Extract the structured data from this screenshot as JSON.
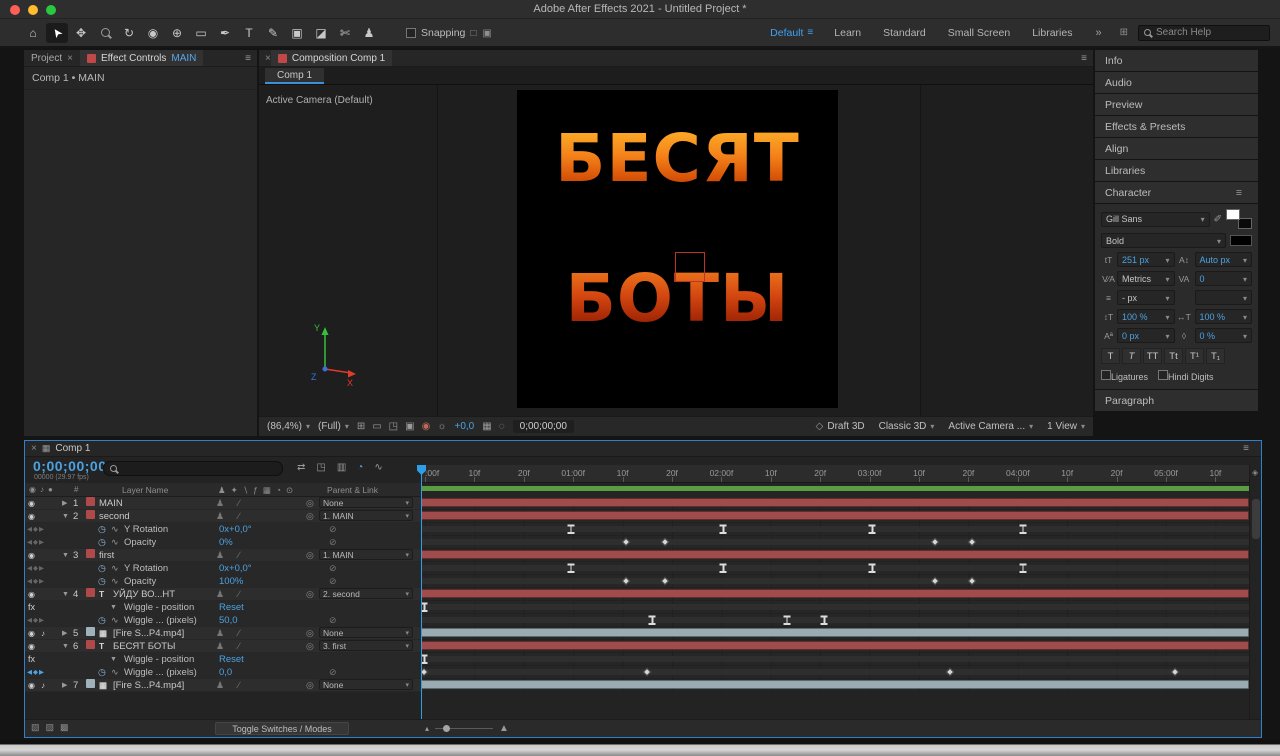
{
  "window": {
    "title": "Adobe After Effects 2021 - Untitled Project *"
  },
  "colors": {
    "accent_blue": "#4ba3e3",
    "workspace_blue": "#3ea1f4",
    "layer_red": "#a04c4c",
    "layer_gray": "#9aacb2",
    "render_green": "#5a9c41",
    "fire_orange": "#f4821a",
    "fire_red": "#c23a0a",
    "tab_chip_red": "#c04848"
  },
  "toolbar": {
    "tools": [
      {
        "name": "home",
        "glyph": "⌂"
      },
      {
        "name": "selection",
        "glyph": "➤",
        "active": true,
        "rotate": -125
      },
      {
        "name": "hand",
        "glyph": "✥"
      },
      {
        "name": "zoom",
        "glyph": "mag"
      },
      {
        "name": "orbit",
        "glyph": "↻"
      },
      {
        "name": "camera",
        "glyph": "◉"
      },
      {
        "name": "pan-behind",
        "glyph": "⊕"
      },
      {
        "name": "rectangle",
        "glyph": "▭"
      },
      {
        "name": "pen",
        "glyph": "✒"
      },
      {
        "name": "type",
        "glyph": "T"
      },
      {
        "name": "brush",
        "glyph": "✎"
      },
      {
        "name": "clone-stamp",
        "glyph": "▣"
      },
      {
        "name": "eraser",
        "glyph": "◪"
      },
      {
        "name": "roto-brush",
        "glyph": "✄"
      },
      {
        "name": "puppet-pin",
        "glyph": "♟"
      }
    ],
    "snapping": "Snapping",
    "snap_icons": [
      "□",
      "▣"
    ],
    "workspaces": [
      {
        "label": "Default",
        "active": true
      },
      {
        "label": "Learn"
      },
      {
        "label": "Standard"
      },
      {
        "label": "Small Screen"
      },
      {
        "label": "Libraries"
      }
    ],
    "workspace_menu_icon": "≡",
    "overflow": "»",
    "panel_icon": "⊞",
    "search_placeholder": "Search Help"
  },
  "left_panel": {
    "tab_project": "Project",
    "close_icon": "×",
    "tab_effect_controls": "Effect Controls",
    "tab_effect_controls_layer": "MAIN",
    "menu_icon": "≡",
    "content_header": "Comp 1 • MAIN"
  },
  "comp_panel": {
    "close_icon": "×",
    "tab_label": "Composition Comp 1",
    "menu_icon": "≡",
    "viewer_tab": "Comp 1",
    "camera_label": "Active Camera (Default)",
    "text_line1": "БЕСЯТ",
    "text_line2": "БОТЫ",
    "axis": {
      "x": "X",
      "y": "Y",
      "z": "Z"
    },
    "footer": {
      "zoom": "(86,4%)",
      "resolution": "(Full)",
      "icons_a": [
        {
          "name": "transparency-grid-icon",
          "glyph": "⊞"
        },
        {
          "name": "mask-visibility-icon",
          "glyph": "▭"
        },
        {
          "name": "region-of-interest-icon",
          "glyph": "◳"
        },
        {
          "name": "grid-guides-icon",
          "glyph": "▣"
        },
        {
          "name": "show-channel-icon",
          "glyph": "◉",
          "color": "#c06a5a"
        },
        {
          "name": "exposure-icon",
          "glyph": "☼"
        }
      ],
      "offset": "+0,0",
      "icons_b": [
        {
          "name": "snapshot-icon",
          "glyph": "▦"
        },
        {
          "name": "show-snapshot-icon",
          "glyph": "◌"
        }
      ],
      "timecode": "0;00;00;00",
      "draft_icon": "◇",
      "draft_label": "Draft 3D",
      "renderer": "Classic 3D",
      "camera_view": "Active Camera ...",
      "view_layout": "1 View"
    }
  },
  "right_panel": {
    "collapsed_panels": [
      "Info",
      "Audio",
      "Preview",
      "Effects & Presets",
      "Align",
      "Libraries"
    ],
    "character": {
      "title": "Character",
      "menu_icon": "≡",
      "font_family": "Gill Sans",
      "font_style": "Bold",
      "icon_eyedropper": "✐",
      "icon_size": "tT",
      "icon_leading": "A↕",
      "icon_kerning": "V∕A",
      "icon_tracking": "VA",
      "icon_stroke": "≡",
      "icon_vscale": "↕T",
      "icon_hscale": "↔T",
      "icon_baseline": "Aª",
      "icon_tsume": "◊",
      "font_size": "251 px",
      "leading": "Auto px",
      "kerning": "Metrics",
      "tracking": "0",
      "stroke_width": "- px",
      "stroke_style": "",
      "vertical_scale": "100 %",
      "horizontal_scale": "100 %",
      "baseline_shift": "0 px",
      "tsume": "0 %",
      "t_buttons": [
        {
          "name": "faux-bold",
          "label": "T"
        },
        {
          "name": "faux-italic",
          "label": "T"
        },
        {
          "name": "all-caps",
          "label": "TT"
        },
        {
          "name": "small-caps",
          "label": "Tt"
        },
        {
          "name": "superscript",
          "label": "T¹"
        },
        {
          "name": "subscript",
          "label": "T₁"
        }
      ],
      "ligatures_label": "Ligatures",
      "hindi_digits_label": "Hindi Digits"
    },
    "paragraph_title": "Paragraph"
  },
  "timeline": {
    "close_icon": "×",
    "comp_icon": "▦",
    "tab_label": "Comp 1",
    "menu_icon": "≡",
    "timecode": "0;00;00;00",
    "frame_info": "00000 (29.97 fps)",
    "icons": [
      {
        "name": "mini-flowchart-icon",
        "glyph": "⇄"
      },
      {
        "name": "draft-3d-icon",
        "glyph": "◳"
      },
      {
        "name": "frame-blending-icon",
        "glyph": "▥"
      },
      {
        "name": "motion-blur-icon",
        "glyph": "◔",
        "active": true
      },
      {
        "name": "graph-editor-icon",
        "glyph": "∿"
      }
    ],
    "columns": {
      "av_icons": "◉♪●",
      "index": "#",
      "layer_name": "Layer Name",
      "switch_icons": "♟✦∖ƒ▦◔⊙",
      "parent": "Parent & Link"
    },
    "glyphs": {
      "eye": "◉",
      "audio": "♪",
      "twirl_open": "▼",
      "twirl_closed": "▶",
      "pickwhip": "◎",
      "stopwatch": "◷",
      "graph": "∿",
      "nav": "◀◆▶",
      "no_parent": "⊘",
      "fx_badge": "fx"
    },
    "ruler_labels": [
      ":00f",
      "10f",
      "20f",
      "01:00f",
      "10f",
      "20f",
      "02:00f",
      "10f",
      "20f",
      "03:00f",
      "10f",
      "20f",
      "04:00f",
      "10f",
      "20f",
      "05:00f",
      "10f"
    ],
    "cti_frac": 0,
    "marker_well_icon": "◈",
    "rows": [
      {
        "type": "layer",
        "num": "1",
        "name": "MAIN",
        "chip": "#b04a4a",
        "eye": true,
        "twirl": "closed",
        "switches": "♟∕",
        "parent": "None",
        "bar": "red"
      },
      {
        "type": "layer",
        "num": "2",
        "name": "second",
        "chip": "#b04a4a",
        "eye": true,
        "twirl": "open",
        "switches": "♟∕",
        "parent": "1. MAIN",
        "bar": "red"
      },
      {
        "type": "prop",
        "name": "Y Rotation",
        "value": "0x+0,0°",
        "kstyle": "ibeam",
        "keys": [
          0.181,
          0.365,
          0.545,
          0.727
        ]
      },
      {
        "type": "prop",
        "name": "Opacity",
        "value": "0%",
        "kstyle": "diamond",
        "keys": [
          0.248,
          0.295,
          0.621,
          0.665
        ]
      },
      {
        "type": "layer",
        "num": "3",
        "name": "first",
        "chip": "#b04a4a",
        "eye": true,
        "twirl": "open",
        "switches": "♟∕",
        "parent": "1. MAIN",
        "bar": "red"
      },
      {
        "type": "prop",
        "name": "Y Rotation",
        "value": "0x+0,0°",
        "kstyle": "ibeam",
        "keys": [
          0.181,
          0.365,
          0.545,
          0.727
        ]
      },
      {
        "type": "prop",
        "name": "Opacity",
        "value": "100%",
        "kstyle": "diamond",
        "keys": [
          0.248,
          0.295,
          0.621,
          0.665
        ]
      },
      {
        "type": "layer",
        "num": "4",
        "name": "УЙДУ ВО...НТ",
        "icon": "T",
        "chip": "#b04a4a",
        "eye": true,
        "twirl": "open",
        "switches": "♟∕",
        "parent": "2. second",
        "bar": "red"
      },
      {
        "type": "fx",
        "name": "Wiggle - position",
        "value": "Reset",
        "kstyle": "ibeam",
        "keys": [
          0.004
        ]
      },
      {
        "type": "prop",
        "name": "Wiggle ... (pixels)",
        "value": "50,0",
        "kstyle": "ibeam",
        "keys": [
          0.279,
          0.442,
          0.487
        ]
      },
      {
        "type": "layer",
        "num": "5",
        "name": "[Fire S...P4.mp4]",
        "icon": "▦",
        "chip": "#9fb2bc",
        "eye": true,
        "audio": true,
        "twirl": "closed",
        "switches": "♟∕",
        "parent": "None",
        "bar": "gray"
      },
      {
        "type": "layer",
        "num": "6",
        "name": "БЕСЯТ БОТЫ",
        "icon": "T",
        "chip": "#b04a4a",
        "eye": true,
        "twirl": "open",
        "switches": "♟∕",
        "parent": "3. first",
        "bar": "red"
      },
      {
        "type": "fx",
        "name": "Wiggle - position",
        "value": "Reset",
        "kstyle": "ibeam",
        "keys": [
          0.004
        ]
      },
      {
        "type": "prop",
        "name": "Wiggle ... (pixels)",
        "value": "0,0",
        "kstyle": "diamond",
        "keys": [
          0.004,
          0.273,
          0.639,
          0.911
        ],
        "nav_active": true
      },
      {
        "type": "layer",
        "num": "7",
        "name": "[Fire S...P4.mp4]",
        "icon": "▦",
        "chip": "#9fb2bc",
        "eye": true,
        "audio": true,
        "twirl": "closed",
        "switches": "♟∕",
        "parent": "None",
        "bar": "gray"
      }
    ],
    "footer": {
      "toggle_button": "Toggle Switches / Modes",
      "pane_icons": [
        "▧",
        "▨",
        "▩"
      ],
      "zoom_out_icon": "▴",
      "zoom_in_icon": "▲"
    }
  }
}
